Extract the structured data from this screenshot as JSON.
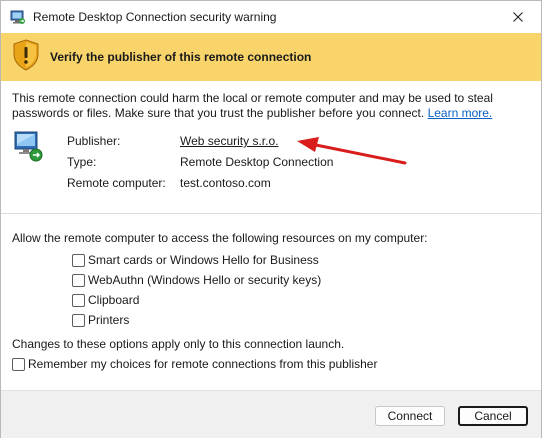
{
  "window": {
    "title": "Remote Desktop Connection security warning"
  },
  "banner": {
    "heading": "Verify the publisher of this remote connection",
    "color": "#f8d46a"
  },
  "warning": {
    "text": "This remote connection could harm the local or remote computer and may be used to steal passwords or files. Make sure that you trust the publisher before you connect.",
    "link_label": "Learn more."
  },
  "details": {
    "publisher_label": "Publisher:",
    "publisher_value": "Web security s.r.o.",
    "type_label": "Type:",
    "type_value": "Remote Desktop Connection",
    "computer_label": "Remote computer:",
    "computer_value": "test.contoso.com"
  },
  "resources": {
    "intro": "Allow the remote computer to access the following resources on my computer:",
    "items": [
      {
        "label": "Smart cards or Windows Hello for Business",
        "checked": false
      },
      {
        "label": "WebAuthn (Windows Hello or security keys)",
        "checked": false
      },
      {
        "label": "Clipboard",
        "checked": false
      },
      {
        "label": "Printers",
        "checked": false
      }
    ]
  },
  "notes": {
    "changes": "Changes to these options apply only to this connection launch.",
    "remember_label": "Remember my choices for remote connections from this publisher",
    "remember_checked": false
  },
  "buttons": {
    "connect": "Connect",
    "cancel": "Cancel"
  },
  "colors": {
    "link": "#0a5fc4",
    "arrow": "#d91c1c"
  }
}
